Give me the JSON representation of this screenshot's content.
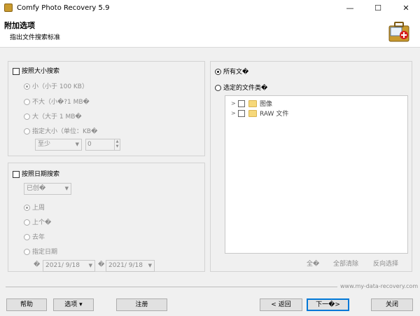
{
  "window": {
    "title": "Comfy Photo Recovery 5.9"
  },
  "header": {
    "title": "附加选项",
    "subtitle": "指出文件搜索标准"
  },
  "size_search": {
    "label": "按照大小搜索",
    "options": [
      "小（小于 100 KB）",
      "不大（小�?1 MB�",
      "大（大于 1 MB�",
      "指定大小（单位：KB�"
    ],
    "selected_index": 0,
    "combo_value": "至少",
    "spin_value": "0"
  },
  "date_search": {
    "label": "按照日期搜索",
    "combo_value": "已创�",
    "options": [
      "上周",
      "上个�",
      "去年",
      "指定日期"
    ],
    "selected_index": 0,
    "from_prefix": "�",
    "from_date": "2021/ 9/18",
    "to_prefix": "�",
    "to_date": "2021/ 9/18"
  },
  "file_types": {
    "all_label": "所有文�",
    "selected_label": "选定的文件类�",
    "tree": [
      "图像",
      "RAW 文件"
    ],
    "select_all": "全�",
    "clear_all": "全部清除",
    "invert": "反向选择"
  },
  "footer": {
    "site": "www.my-data-recovery.com",
    "help": "帮助",
    "options": "选项 ▾",
    "register": "注册",
    "back": "< 返回",
    "next": "下一�>",
    "close": "关闭"
  }
}
